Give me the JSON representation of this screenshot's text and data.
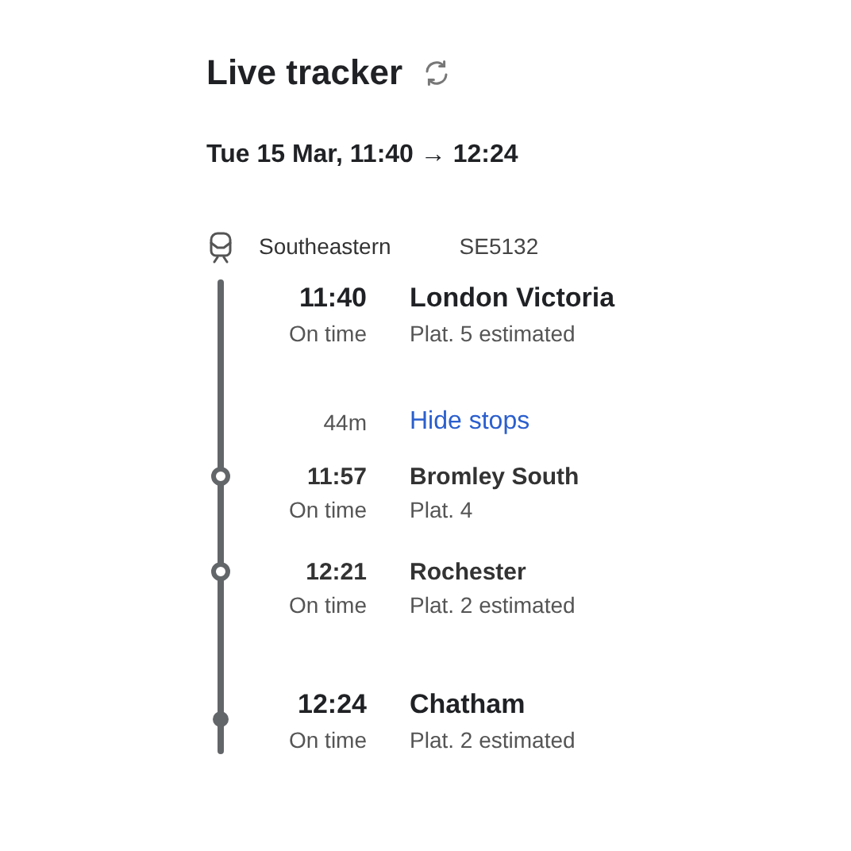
{
  "title": "Live tracker",
  "journey": "Tue 15 Mar, 11:40 → 12:24",
  "service": {
    "operator": "Southeastern",
    "code": "SE5132"
  },
  "stops": [
    {
      "kind": "origin",
      "time": "11:40",
      "status": "On time",
      "name": "London Victoria",
      "platform": "Plat. 5 estimated"
    },
    {
      "kind": "duration",
      "time": "44m",
      "link": "Hide stops"
    },
    {
      "kind": "stop",
      "time": "11:57",
      "status": "On time",
      "name": "Bromley South",
      "platform": "Plat. 4"
    },
    {
      "kind": "stop",
      "time": "12:21",
      "status": "On time",
      "name": "Rochester",
      "platform": "Plat. 2 estimated"
    },
    {
      "kind": "destination",
      "time": "12:24",
      "status": "On time",
      "name": "Chatham",
      "platform": "Plat. 2 estimated"
    }
  ]
}
